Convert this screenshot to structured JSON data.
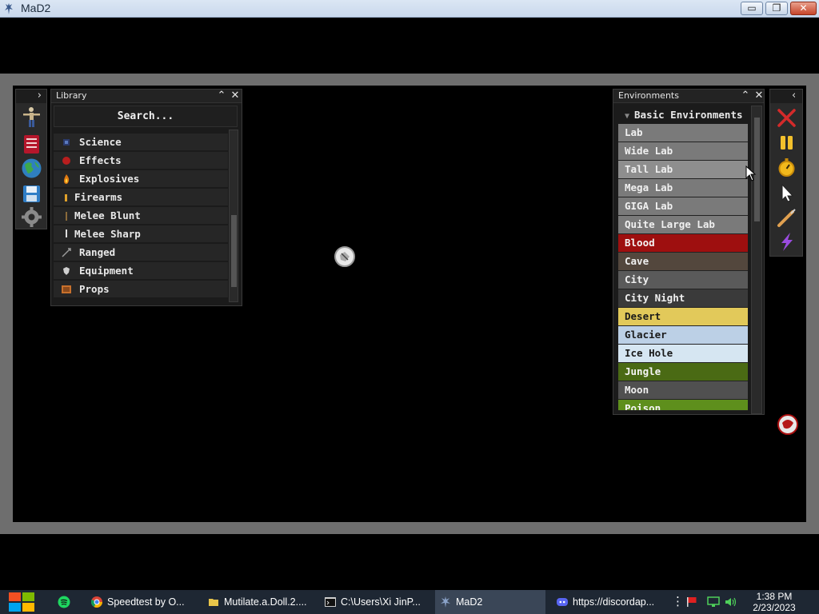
{
  "window": {
    "title": "MaD2",
    "min_label": "▭",
    "max_label": "❐",
    "close_label": "✕"
  },
  "left_toolbar": {
    "toggle": "›",
    "tools": [
      "ragdoll-icon",
      "book-icon",
      "globe-icon",
      "save-icon",
      "gear-icon"
    ]
  },
  "library": {
    "title": "Library",
    "search_placeholder": "Search...",
    "items": [
      {
        "label": "Science",
        "icon": "science-icon",
        "color": "#2b3a6b"
      },
      {
        "label": "Effects",
        "icon": "effects-icon",
        "color": "#b81e1e"
      },
      {
        "label": "Explosives",
        "icon": "fire-icon",
        "color": "#e07a12"
      },
      {
        "label": "Firearms",
        "icon": "bullet-icon",
        "color": "#e0a12a"
      },
      {
        "label": "Melee Blunt",
        "icon": "blunt-icon",
        "color": "#8a6a3a"
      },
      {
        "label": "Melee Sharp",
        "icon": "blade-icon",
        "color": "#dddddd"
      },
      {
        "label": "Ranged",
        "icon": "arrow-icon",
        "color": "#9a9a9a"
      },
      {
        "label": "Equipment",
        "icon": "shield-icon",
        "color": "#cfcfcf"
      },
      {
        "label": "Props",
        "icon": "crate-icon",
        "color": "#c7702c"
      }
    ]
  },
  "environments": {
    "title": "Environments",
    "group": "Basic Environments",
    "items": [
      {
        "label": "Lab",
        "bg": "#7a7a7a",
        "fg": "#f0f0f0"
      },
      {
        "label": "Wide Lab",
        "bg": "#7a7a7a",
        "fg": "#f0f0f0"
      },
      {
        "label": "Tall Lab",
        "bg": "#8e8e8e",
        "fg": "#f0f0f0"
      },
      {
        "label": "Mega Lab",
        "bg": "#7a7a7a",
        "fg": "#f0f0f0"
      },
      {
        "label": "GIGA Lab",
        "bg": "#7a7a7a",
        "fg": "#f0f0f0"
      },
      {
        "label": "Quite Large Lab",
        "bg": "#7a7a7a",
        "fg": "#f0f0f0"
      },
      {
        "label": "Blood",
        "bg": "#9e0f0f",
        "fg": "#f5f5f5"
      },
      {
        "label": "Cave",
        "bg": "#53473d",
        "fg": "#f0f0f0"
      },
      {
        "label": "City",
        "bg": "#5a5a5a",
        "fg": "#f0f0f0"
      },
      {
        "label": "City Night",
        "bg": "#3a3a3a",
        "fg": "#f0f0f0"
      },
      {
        "label": "Desert",
        "bg": "#e2c95a",
        "fg": "#1a1a1a"
      },
      {
        "label": "Glacier",
        "bg": "#bcd0e6",
        "fg": "#1a1a1a"
      },
      {
        "label": "Ice Hole",
        "bg": "#d6e6f2",
        "fg": "#1a1a1a"
      },
      {
        "label": "Jungle",
        "bg": "#4a6a14",
        "fg": "#f5f5f5"
      },
      {
        "label": "Moon",
        "bg": "#505050",
        "fg": "#f0f0f0"
      },
      {
        "label": "Poison",
        "bg": "#5e8f1c",
        "fg": "#f5f5f5"
      }
    ]
  },
  "right_toolbar": {
    "toggle": "‹",
    "tools": [
      "close-x-icon",
      "pause-icon",
      "stopwatch-icon",
      "pointer-icon",
      "syringe-icon",
      "lightning-icon"
    ]
  },
  "taskbar": {
    "items": [
      {
        "label": "Speedtest by O...",
        "icon": "chrome-icon",
        "color": "#e4a21f"
      },
      {
        "label": "Mutilate.a.Doll.2....",
        "icon": "folder-icon",
        "color": "#e8c54a"
      },
      {
        "label": "C:\\Users\\Xi JinP...",
        "icon": "cmd-icon",
        "color": "#cfcfcf"
      },
      {
        "label": "MaD2",
        "icon": "mad2-icon",
        "color": "#8aa2c8"
      },
      {
        "label": "https://discordap...",
        "icon": "discord-icon",
        "color": "#5865f2"
      }
    ],
    "time": "1:38 PM",
    "date": "2/23/2023"
  }
}
